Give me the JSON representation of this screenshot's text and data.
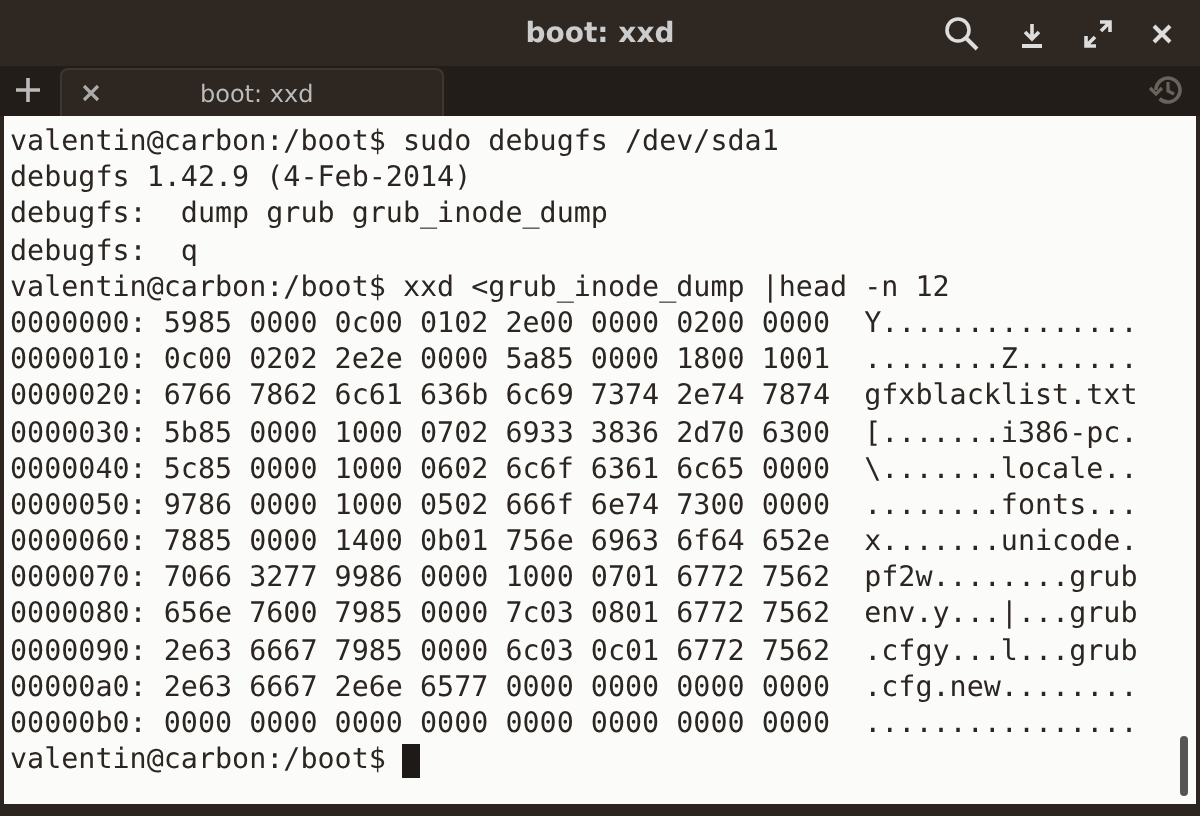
{
  "window": {
    "title": "boot: xxd"
  },
  "tabs": [
    {
      "label": "boot: xxd",
      "selected": true
    }
  ],
  "terminal": {
    "cursor_visible": true,
    "lines": [
      "valentin@carbon:/boot$ sudo debugfs /dev/sda1",
      "debugfs 1.42.9 (4-Feb-2014)",
      "debugfs:  dump grub grub_inode_dump",
      "debugfs:  q",
      "valentin@carbon:/boot$ xxd <grub_inode_dump |head -n 12",
      "0000000: 5985 0000 0c00 0102 2e00 0000 0200 0000  Y...............",
      "0000010: 0c00 0202 2e2e 0000 5a85 0000 1800 1001  ........Z.......",
      "0000020: 6766 7862 6c61 636b 6c69 7374 2e74 7874  gfxblacklist.txt",
      "0000030: 5b85 0000 1000 0702 6933 3836 2d70 6300  [.......i386-pc.",
      "0000040: 5c85 0000 1000 0602 6c6f 6361 6c65 0000  \\.......locale..",
      "0000050: 9786 0000 1000 0502 666f 6e74 7300 0000  ........fonts...",
      "0000060: 7885 0000 1400 0b01 756e 6963 6f64 652e  x.......unicode.",
      "0000070: 7066 3277 9986 0000 1000 0701 6772 7562  pf2w........grub",
      "0000080: 656e 7600 7985 0000 7c03 0801 6772 7562  env.y...|...grub",
      "0000090: 2e63 6667 7985 0000 6c03 0c01 6772 7562  .cfgy...l...grub",
      "00000a0: 2e63 6667 2e6e 6577 0000 0000 0000 0000  .cfg.new........",
      "00000b0: 0000 0000 0000 0000 0000 0000 0000 0000  ................",
      "valentin@carbon:/boot$ "
    ]
  }
}
